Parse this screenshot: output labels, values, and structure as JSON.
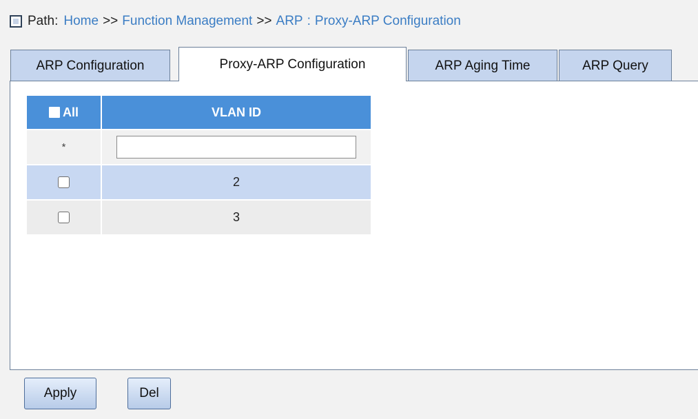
{
  "breadcrumb": {
    "label": "Path:",
    "items": [
      "Home",
      "Function Management",
      "ARP",
      "Proxy-ARP Configuration"
    ],
    "separator": ">>",
    "separator2": ":"
  },
  "tabs": [
    {
      "label": "ARP Configuration",
      "active": false
    },
    {
      "label": "Proxy-ARP Configuration",
      "active": true
    },
    {
      "label": "ARP Aging Time",
      "active": false
    },
    {
      "label": "ARP Query",
      "active": false
    }
  ],
  "table": {
    "select_all_label": "All",
    "column_header": "VLAN ID",
    "filter_marker": "*",
    "filter_value": "",
    "rows": [
      {
        "checked": false,
        "vlan_id": "2"
      },
      {
        "checked": false,
        "vlan_id": "3"
      }
    ]
  },
  "buttons": {
    "apply_label": "Apply",
    "delete_label": "Del"
  },
  "colors": {
    "header_blue": "#4a90d9",
    "tab_bg": "#c5d5ee",
    "link": "#3b7dc4",
    "row_highlight": "#c8d8f2"
  }
}
